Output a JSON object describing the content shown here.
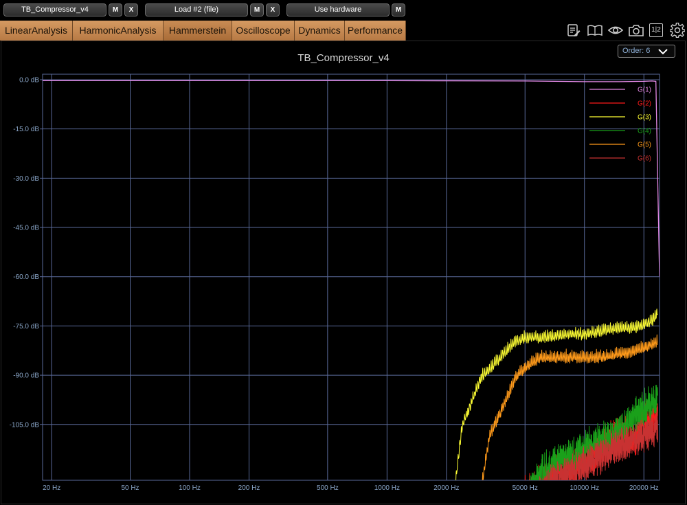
{
  "toolbar": {
    "slot1": "TB_Compressor_v4",
    "slot2": "Load #2 (file)",
    "slot3": "Use hardware",
    "m_label": "M",
    "x_label": "X"
  },
  "tabs": [
    "LinearAnalysis",
    "HarmonicAnalysis",
    "Hammerstein",
    "Oscilloscope",
    "Dynamics",
    "Performance"
  ],
  "active_tab": "Hammerstein",
  "icons": [
    "notes-icon",
    "book-icon",
    "eye-icon",
    "camera-icon",
    "split-view-icon",
    "gear-icon"
  ],
  "split_view_label": "1|2",
  "order_select": {
    "value": "Order: 6"
  },
  "colors": {
    "tab": "#c98a52",
    "grid": "#5a6a9a",
    "axis_label": "#8aa6c8",
    "G1": "#e58ae8",
    "G2": "#ff1a1a",
    "G3": "#ffff33",
    "G4": "#1aa01a",
    "G5": "#ff9a1a",
    "G6": "#c83232"
  },
  "chart_data": {
    "type": "line",
    "title": "TB_Compressor_v4",
    "x_scale": "log",
    "xlim": [
      18,
      24000
    ],
    "ylim": [
      -122,
      0
    ],
    "y_ticks": [
      "0.0 dB",
      "-15.0 dB",
      "-30.0 dB",
      "-45.0 dB",
      "-60.0 dB",
      "-75.0 dB",
      "-90.0 dB",
      "-105.0 dB"
    ],
    "y_tick_values": [
      0,
      -15,
      -30,
      -45,
      -60,
      -75,
      -90,
      -105
    ],
    "x_ticks": [
      "20 Hz",
      "50 Hz",
      "100 Hz",
      "200 Hz",
      "500 Hz",
      "1000 Hz",
      "2000 Hz",
      "5000 Hz",
      "10000 Hz",
      "20000 Hz"
    ],
    "x_tick_values": [
      20,
      50,
      100,
      200,
      500,
      1000,
      2000,
      5000,
      10000,
      20000
    ],
    "grid": true,
    "legend_position": "top-right",
    "series": [
      {
        "name": "G(1)",
        "x": [
          18,
          100,
          1000,
          5000,
          10000,
          15000,
          20000,
          22000,
          23000,
          24000
        ],
        "y": [
          -0.3,
          -0.3,
          -0.3,
          -0.4,
          -0.6,
          -0.6,
          -0.5,
          -0.4,
          -0.5,
          -60
        ]
      },
      {
        "name": "G(2)",
        "x": [
          4500,
          6000,
          8000,
          10000,
          12000,
          15000,
          18000,
          20000,
          22000,
          23500
        ],
        "y": [
          -122,
          -117,
          -112,
          -110,
          -106,
          -100,
          -104,
          -96,
          -98,
          -95
        ]
      },
      {
        "name": "G(3)",
        "x": [
          2200,
          2400,
          2700,
          3000,
          3500,
          4000,
          4500,
          5000,
          6000,
          8000,
          10000,
          12000,
          15000,
          18000,
          20000,
          22000,
          23500
        ],
        "y": [
          -122,
          -103,
          -95,
          -88,
          -84,
          -80,
          -77,
          -76,
          -76,
          -75,
          -75,
          -74,
          -73,
          -73,
          -72,
          -71,
          -68
        ]
      },
      {
        "name": "G(4)",
        "x": [
          5000,
          6000,
          8000,
          10000,
          12000,
          15000,
          18000,
          20000,
          22000,
          23500
        ],
        "y": [
          -122,
          -114,
          -108,
          -106,
          -104,
          -101,
          -96,
          -94,
          -92,
          -90
        ]
      },
      {
        "name": "G(5)",
        "x": [
          3000,
          3300,
          3800,
          4500,
          5000,
          6000,
          8000,
          10000,
          12000,
          15000,
          18000,
          20000,
          22000,
          23500
        ],
        "y": [
          -122,
          -106,
          -98,
          -88,
          -85,
          -82,
          -82,
          -82,
          -82,
          -81,
          -80,
          -79,
          -78,
          -77
        ]
      },
      {
        "name": "G(6)",
        "x": [
          5500,
          7000,
          9000,
          11000,
          14000,
          17000,
          20000,
          22000,
          23500
        ],
        "y": [
          -122,
          -116,
          -112,
          -110,
          -106,
          -104,
          -102,
          -101,
          -99
        ]
      }
    ]
  }
}
